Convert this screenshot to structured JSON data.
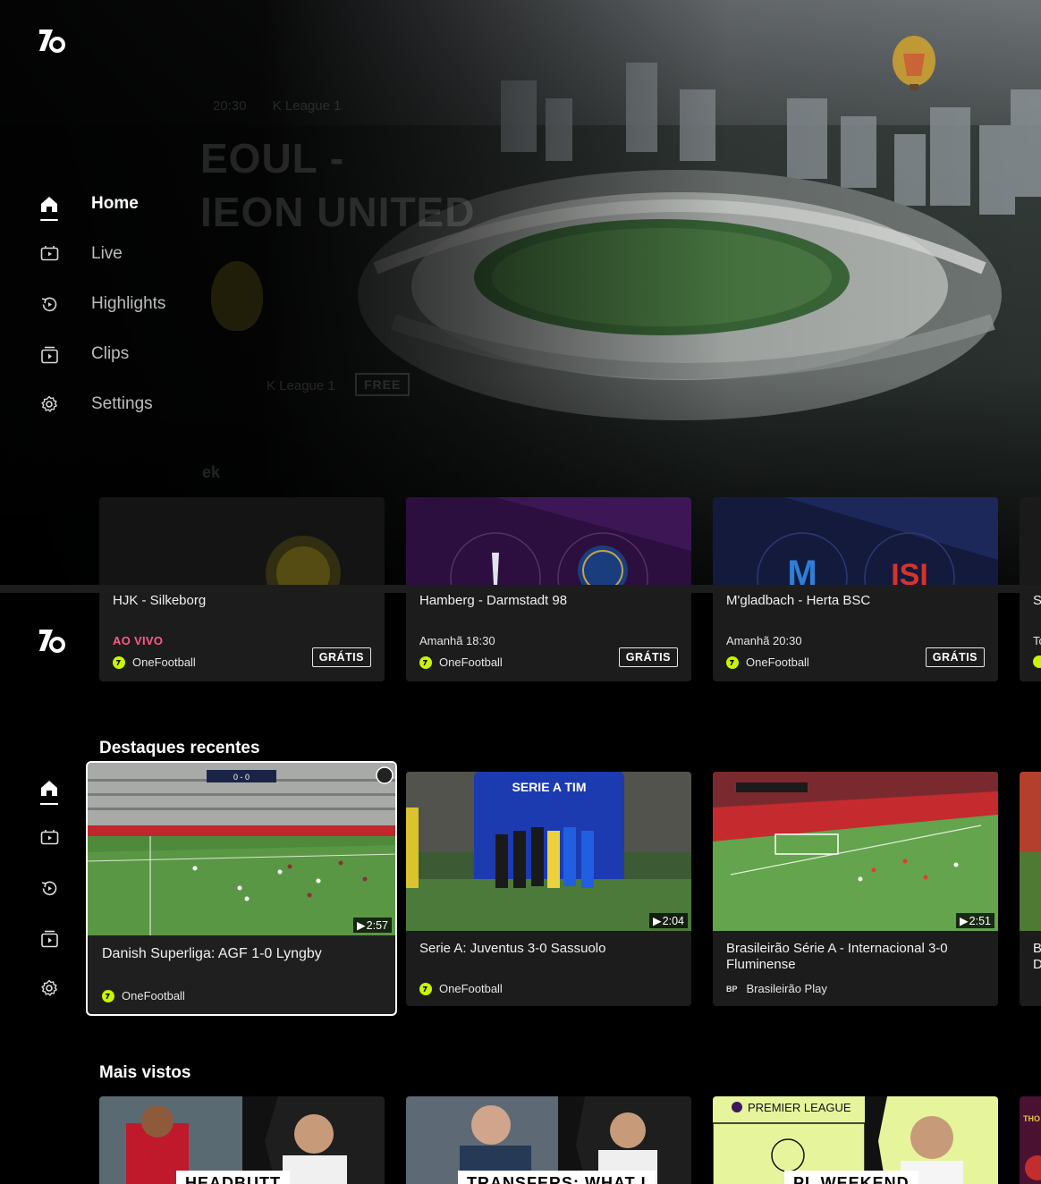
{
  "app": {
    "name": "OneFootball"
  },
  "menu": {
    "items": [
      {
        "label": "Home",
        "icon": "home-icon",
        "active": true
      },
      {
        "label": "Live",
        "icon": "live-tv-icon"
      },
      {
        "label": "Highlights",
        "icon": "replay-icon"
      },
      {
        "label": "Clips",
        "icon": "clips-icon"
      },
      {
        "label": "Settings",
        "icon": "gear-icon"
      }
    ]
  },
  "hero": {
    "time": "20:30",
    "league": "K League 1",
    "title_line1": "EOUL -",
    "title_line2": "IEON UNITED",
    "badge": "FREE",
    "section_partial": "ek"
  },
  "live_row": {
    "cards": [
      {
        "title": "HJK - Silkeborg",
        "status": "AO VIVO",
        "live": true,
        "source": "OneFootball",
        "badge": "GRÁTIS"
      },
      {
        "title": "Hamberg - Darmstadt 98",
        "status": "Amanhã 18:30",
        "source": "OneFootball",
        "badge": "GRÁTIS"
      },
      {
        "title": "M'gladbach - Herta BSC",
        "status": "Amanhã 20:30",
        "source": "OneFootball",
        "badge": "GRÁTIS"
      },
      {
        "title": "S",
        "status": "To"
      }
    ]
  },
  "highlights": {
    "title": "Destaques recentes",
    "cards": [
      {
        "title": "Danish Superliga: AGF 1-0 Lyngby",
        "duration": "2:57",
        "source": "OneFootball",
        "focused": true,
        "score": "0 - 0"
      },
      {
        "title": "Serie A: Juventus 3-0 Sassuolo",
        "duration": "2:04",
        "source": "OneFootball",
        "banner": "SERIE A TIM"
      },
      {
        "title": "Brasileirão Série A - Internacional 3-0 Fluminense",
        "duration": "2:51",
        "source": "Brasileirão Play",
        "source_logo": "BP"
      },
      {
        "title": "B D"
      }
    ]
  },
  "most_viewed": {
    "title": "Mais vistos",
    "cards": [
      {
        "banner": "HEADBUTT"
      },
      {
        "banner": "TRANSFERS: WHAT I"
      },
      {
        "banner": "PL WEEKEND",
        "label": "PREMIER LEAGUE"
      },
      {
        "label": "THO"
      }
    ]
  },
  "colors": {
    "live": "#ff5a87",
    "brand": "#c9f500",
    "card": "#1c1c1c"
  }
}
